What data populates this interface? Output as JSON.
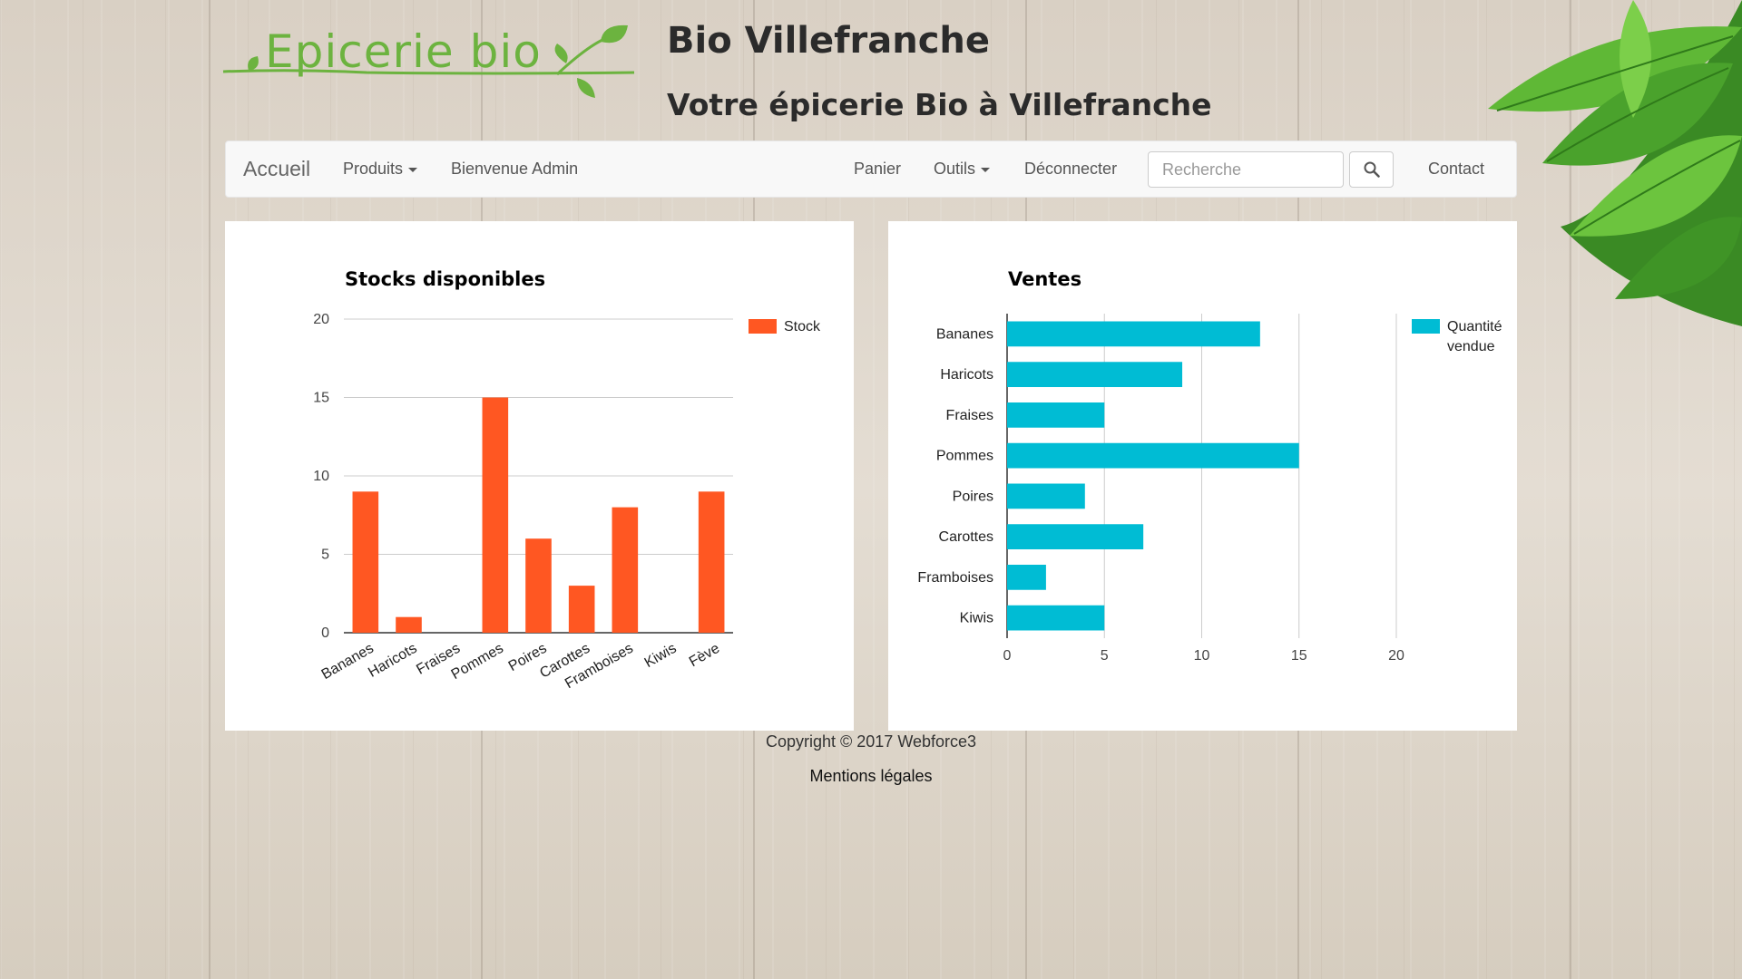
{
  "header": {
    "logo_text": "Epicerie bio",
    "title": "Bio Villefranche",
    "subtitle": "Votre épicerie Bio à Villefranche"
  },
  "nav": {
    "brand": "Accueil",
    "produits": "Produits",
    "welcome": "Bienvenue Admin",
    "panier": "Panier",
    "outils": "Outils",
    "deconnecter": "Déconnecter",
    "search_placeholder": "Recherche",
    "contact": "Contact"
  },
  "icons": [
    "search-icon",
    "caret-down-icon"
  ],
  "colors": {
    "stock": "#ff5722",
    "ventes": "#00bcd4"
  },
  "chart_data": [
    {
      "type": "bar",
      "orientation": "vertical",
      "title": "Stocks disponibles",
      "categories": [
        "Bananes",
        "Haricots",
        "Fraises",
        "Pommes",
        "Poires",
        "Carottes",
        "Framboises",
        "Kiwis",
        "Fève"
      ],
      "series": [
        {
          "name": "Stock",
          "values": [
            9,
            1,
            0,
            15,
            6,
            3,
            8,
            0,
            9
          ]
        }
      ],
      "ylim": [
        0,
        20
      ],
      "yticks": [
        0,
        5,
        10,
        15,
        20
      ],
      "grid": true,
      "legend": "right"
    },
    {
      "type": "bar",
      "orientation": "horizontal",
      "title": "Ventes",
      "categories": [
        "Bananes",
        "Haricots",
        "Fraises",
        "Pommes",
        "Poires",
        "Carottes",
        "Framboises",
        "Kiwis"
      ],
      "series": [
        {
          "name": "Quantité vendue",
          "values": [
            13,
            9,
            5,
            15,
            4,
            7,
            2,
            5
          ]
        }
      ],
      "xlim": [
        0,
        20
      ],
      "xticks": [
        0,
        5,
        10,
        15,
        20
      ],
      "grid": true,
      "legend": "right"
    }
  ],
  "footer": {
    "copyright": "Copyright © 2017 Webforce3",
    "legal": "Mentions légales"
  }
}
